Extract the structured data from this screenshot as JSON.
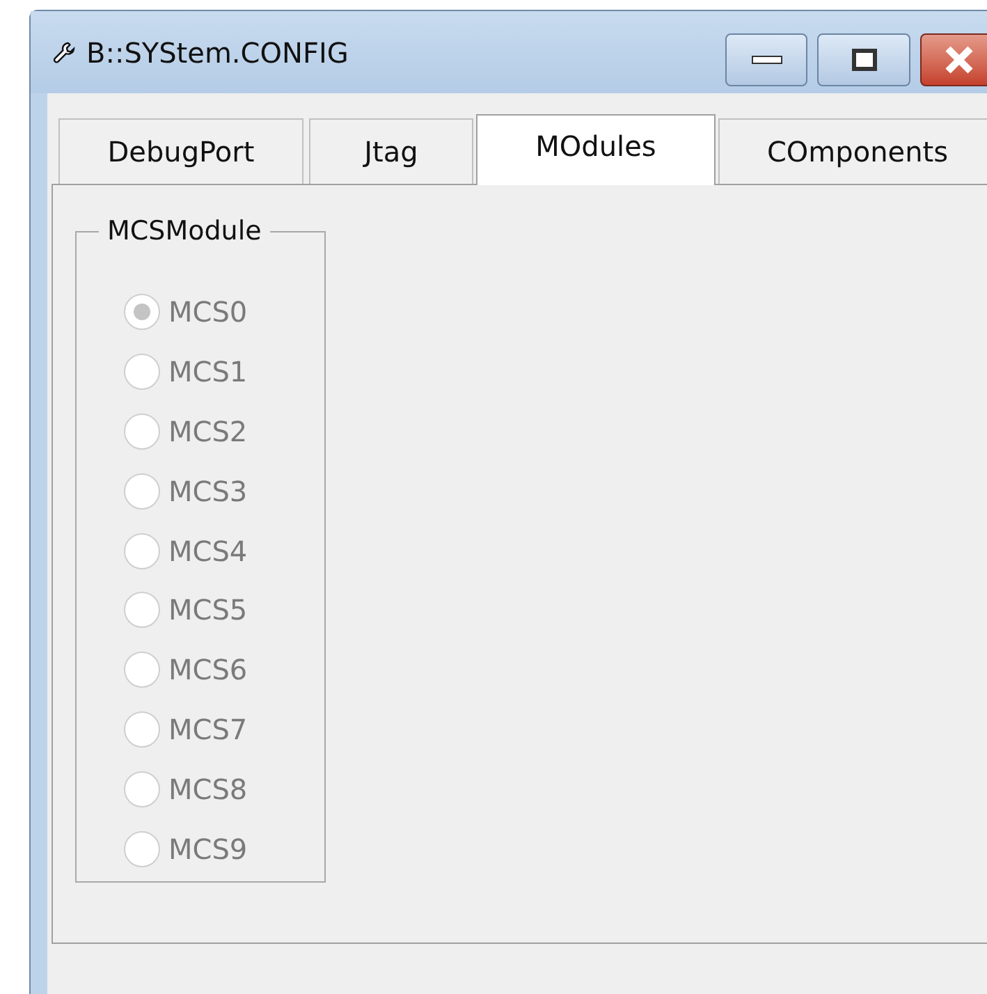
{
  "window": {
    "title": "B::SYStem.CONFIG"
  },
  "tabs": [
    {
      "label": "DebugPort",
      "selected": false
    },
    {
      "label": "Jtag",
      "selected": false
    },
    {
      "label": "MOdules",
      "selected": true
    },
    {
      "label": "COmponents",
      "selected": false
    }
  ],
  "group": {
    "title": "MCSModule",
    "options": [
      {
        "label": "MCS0",
        "selected": true,
        "disabled": true
      },
      {
        "label": "MCS1",
        "selected": false,
        "disabled": true
      },
      {
        "label": "MCS2",
        "selected": false,
        "disabled": true
      },
      {
        "label": "MCS3",
        "selected": false,
        "disabled": true
      },
      {
        "label": "MCS4",
        "selected": false,
        "disabled": true
      },
      {
        "label": "MCS5",
        "selected": false,
        "disabled": true
      },
      {
        "label": "MCS6",
        "selected": false,
        "disabled": true
      },
      {
        "label": "MCS7",
        "selected": false,
        "disabled": true
      },
      {
        "label": "MCS8",
        "selected": false,
        "disabled": true
      },
      {
        "label": "MCS9",
        "selected": false,
        "disabled": true
      }
    ]
  }
}
